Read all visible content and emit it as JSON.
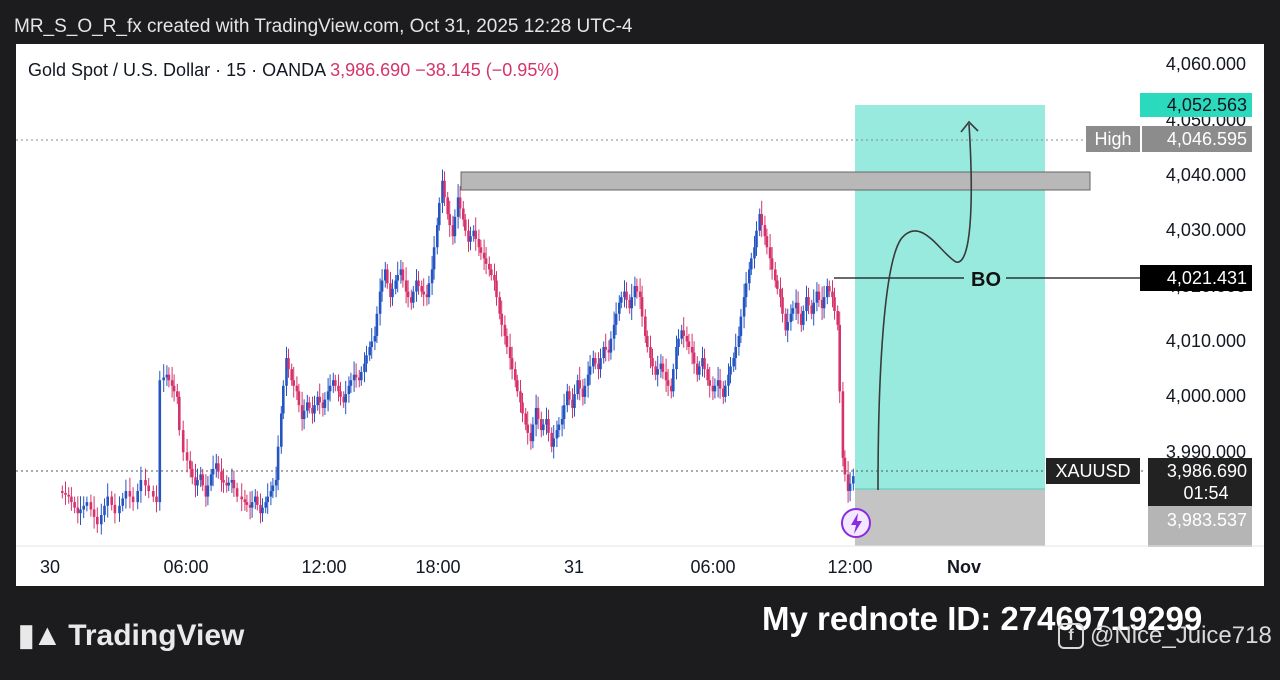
{
  "header": {
    "text": "MR_S_O_R_fx created with TradingView.com, Oct 31, 2025 12:28 UTC-4"
  },
  "legend": {
    "symbol": "Gold Spot / U.S. Dollar · 15 · OANDA",
    "price": "3,986.690",
    "change": "−38.145 (−0.95%)"
  },
  "price_tags": {
    "target": "4,052.563",
    "high_label": "High",
    "high_value": "4,046.595",
    "bo_value": "4,021.431",
    "symbol": "XAUUSD",
    "last": "3,986.690",
    "countdown": "01:54",
    "stop": "3,983.537"
  },
  "annotation": {
    "bo": "BO"
  },
  "colors": {
    "bull": "#2455c3",
    "bear": "#d6336c",
    "target_zone": "#99eade",
    "stop_zone": "#c4c4c4",
    "resistance": "#b8b8b8"
  },
  "footer": {
    "brand": "TradingView",
    "rednote": "My rednote ID: 27469719299",
    "handle": "@Nice_Juice718"
  },
  "chart_data": {
    "type": "candlestick",
    "symbol": "XAUUSD",
    "timeframe": "15",
    "y_ticks": [
      "4,060.000",
      "4,050.000",
      "4,040.000",
      "4,030.000",
      "4,020.000",
      "4,010.000",
      "4,000.000",
      "3,990.000"
    ],
    "x_ticks": [
      "30",
      "06:00",
      "12:00",
      "18:00",
      "31",
      "06:00",
      "12:00",
      "Nov"
    ],
    "ylim": [
      3980,
      4063
    ],
    "levels": {
      "high": 4046.595,
      "breakout": 4021.431,
      "last": 3986.69,
      "target": 4052.563,
      "stop": 3983.537
    },
    "resistance_zone": [
      4037.5,
      4041
    ],
    "path": [
      [
        0,
        3984
      ],
      [
        7,
        3983
      ],
      [
        14,
        3980
      ],
      [
        22,
        3982
      ],
      [
        30,
        3978
      ],
      [
        38,
        3983
      ],
      [
        44,
        3980
      ],
      [
        52,
        3984
      ],
      [
        58,
        3982
      ],
      [
        64,
        3986
      ],
      [
        70,
        3984
      ],
      [
        75,
        3982
      ],
      [
        78,
        4004
      ],
      [
        82,
        4005
      ],
      [
        86,
        4003
      ],
      [
        90,
        4001
      ],
      [
        93,
        3995
      ],
      [
        96,
        3991
      ],
      [
        100,
        3988
      ],
      [
        104,
        3985
      ],
      [
        108,
        3987
      ],
      [
        112,
        3983
      ],
      [
        116,
        3987
      ],
      [
        120,
        3989
      ],
      [
        124,
        3986
      ],
      [
        128,
        3985
      ],
      [
        132,
        3986
      ],
      [
        138,
        3983
      ],
      [
        142,
        3982
      ],
      [
        146,
        3981
      ],
      [
        150,
        3983
      ],
      [
        154,
        3980
      ],
      [
        158,
        3982
      ],
      [
        162,
        3984
      ],
      [
        166,
        3986
      ],
      [
        170,
        3998
      ],
      [
        174,
        4008
      ],
      [
        178,
        4004
      ],
      [
        182,
        4002
      ],
      [
        186,
        3997
      ],
      [
        190,
        4000
      ],
      [
        194,
        3998
      ],
      [
        198,
        4001
      ],
      [
        202,
        3999
      ],
      [
        206,
        4002
      ],
      [
        210,
        4004
      ],
      [
        214,
        4002
      ],
      [
        218,
        4000
      ],
      [
        222,
        4003
      ],
      [
        226,
        4005
      ],
      [
        230,
        4004
      ],
      [
        234,
        4007
      ],
      [
        238,
        4010
      ],
      [
        242,
        4012
      ],
      [
        246,
        4020
      ],
      [
        250,
        4024
      ],
      [
        254,
        4019
      ],
      [
        258,
        4022
      ],
      [
        262,
        4024
      ],
      [
        266,
        4020
      ],
      [
        270,
        4018
      ],
      [
        274,
        4022
      ],
      [
        278,
        4020
      ],
      [
        282,
        4019
      ],
      [
        286,
        4024
      ],
      [
        290,
        4032
      ],
      [
        294,
        4040
      ],
      [
        298,
        4034
      ],
      [
        302,
        4030
      ],
      [
        306,
        4037
      ],
      [
        310,
        4033
      ],
      [
        314,
        4029
      ],
      [
        318,
        4031
      ],
      [
        322,
        4028
      ],
      [
        326,
        4026
      ],
      [
        330,
        4024
      ],
      [
        334,
        4022
      ],
      [
        338,
        4016
      ],
      [
        342,
        4012
      ],
      [
        346,
        4008
      ],
      [
        350,
        4004
      ],
      [
        354,
        4000
      ],
      [
        358,
        3996
      ],
      [
        362,
        3993
      ],
      [
        366,
        3999
      ],
      [
        370,
        3995
      ],
      [
        374,
        3997
      ],
      [
        378,
        3992
      ],
      [
        382,
        3995
      ],
      [
        386,
        3997
      ],
      [
        390,
        4002
      ],
      [
        394,
        3999
      ],
      [
        398,
        4004
      ],
      [
        402,
        4001
      ],
      [
        406,
        4005
      ],
      [
        410,
        4008
      ],
      [
        414,
        4006
      ],
      [
        418,
        4010
      ],
      [
        422,
        4009
      ],
      [
        426,
        4014
      ],
      [
        430,
        4018
      ],
      [
        434,
        4020
      ],
      [
        438,
        4017
      ],
      [
        442,
        4021
      ],
      [
        446,
        4019
      ],
      [
        450,
        4012
      ],
      [
        454,
        4008
      ],
      [
        458,
        4005
      ],
      [
        462,
        4007
      ],
      [
        466,
        4004
      ],
      [
        470,
        4002
      ],
      [
        474,
        4010
      ],
      [
        478,
        4013
      ],
      [
        482,
        4011
      ],
      [
        486,
        4009
      ],
      [
        490,
        4005
      ],
      [
        494,
        4008
      ],
      [
        498,
        4004
      ],
      [
        502,
        4002
      ],
      [
        506,
        4004
      ],
      [
        510,
        4001
      ],
      [
        514,
        4005
      ],
      [
        518,
        4008
      ],
      [
        522,
        4012
      ],
      [
        526,
        4019
      ],
      [
        530,
        4024
      ],
      [
        534,
        4028
      ],
      [
        538,
        4034
      ],
      [
        542,
        4030
      ],
      [
        546,
        4026
      ],
      [
        550,
        4022
      ],
      [
        554,
        4019
      ],
      [
        558,
        4013
      ],
      [
        562,
        4016
      ],
      [
        566,
        4018
      ],
      [
        570,
        4014
      ],
      [
        574,
        4019
      ],
      [
        578,
        4016
      ],
      [
        582,
        4020
      ],
      [
        586,
        4017
      ],
      [
        590,
        4021
      ],
      [
        594,
        4019
      ],
      [
        598,
        4014
      ],
      [
        602,
        3990
      ],
      [
        606,
        3984
      ],
      [
        610,
        3986.69
      ]
    ]
  }
}
